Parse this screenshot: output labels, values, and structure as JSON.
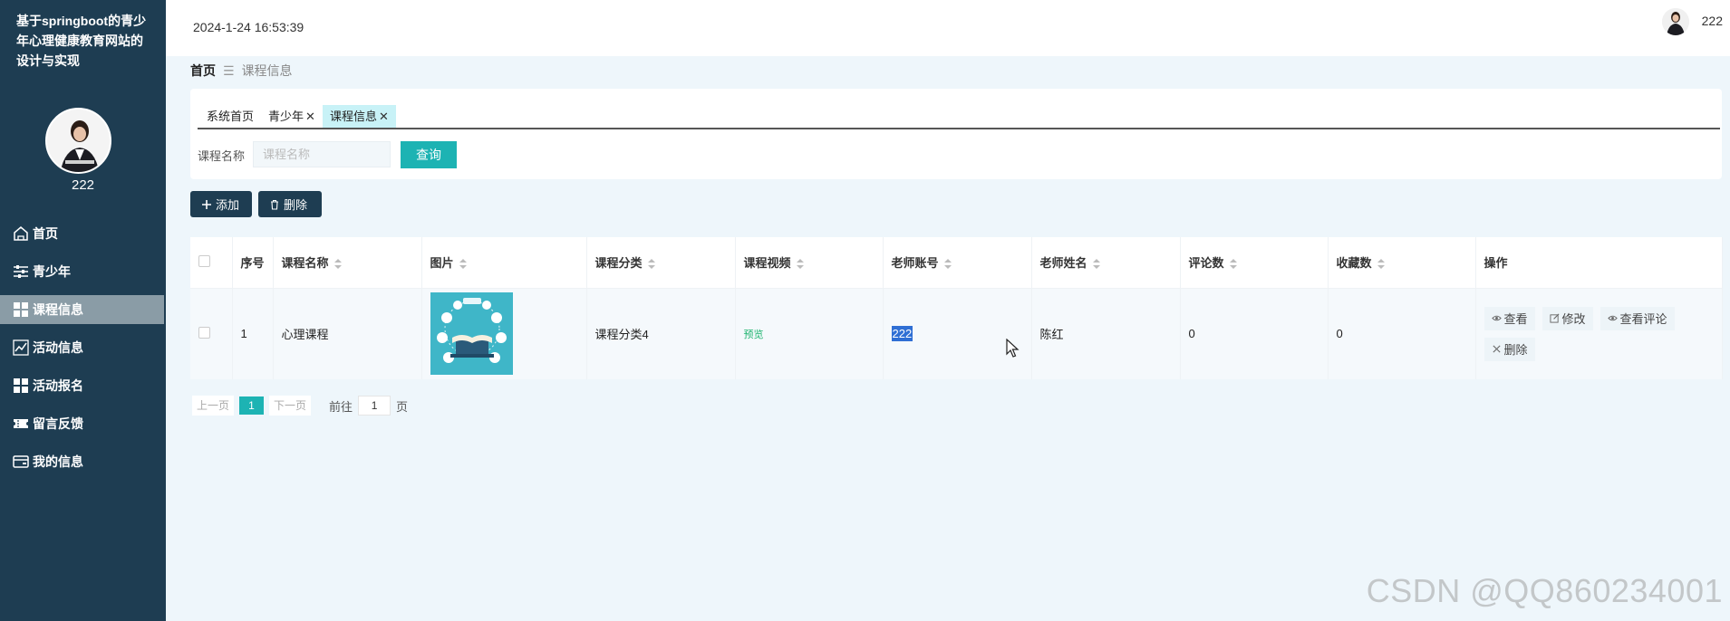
{
  "sidebar": {
    "system_title": "基于springboot的青少年心理健康教育网站的设计与实现",
    "username": "222",
    "menu": [
      {
        "label": "首页",
        "icon": "home-icon"
      },
      {
        "label": "青少年",
        "icon": "sliders-icon"
      },
      {
        "label": "课程信息",
        "icon": "grid-icon",
        "active": true
      },
      {
        "label": "活动信息",
        "icon": "chart-line-icon"
      },
      {
        "label": "活动报名",
        "icon": "grid-icon"
      },
      {
        "label": "留言反馈",
        "icon": "ticket-icon"
      },
      {
        "label": "我的信息",
        "icon": "card-icon"
      }
    ]
  },
  "header": {
    "datetime": "2024-1-24 16:53:39",
    "username": "222"
  },
  "breadcrumb": {
    "home": "首页",
    "separator": "☰",
    "current": "课程信息"
  },
  "tabs": [
    {
      "label": "系统首页",
      "closable": false
    },
    {
      "label": "青少年",
      "closable": true
    },
    {
      "label": "课程信息",
      "closable": true,
      "active": true
    }
  ],
  "search": {
    "label": "课程名称",
    "placeholder": "课程名称",
    "value": "",
    "button": "查询"
  },
  "actions": {
    "add": "添加",
    "delete": "删除"
  },
  "table": {
    "columns": [
      "序号",
      "课程名称",
      "图片",
      "课程分类",
      "课程视频",
      "老师账号",
      "老师姓名",
      "评论数",
      "收藏数",
      "操作"
    ],
    "rows": [
      {
        "index": "1",
        "name": "心理课程",
        "category": "课程分类4",
        "video": "预览",
        "teacher_account": "222",
        "teacher_name": "陈红",
        "comments": "0",
        "favorites": "0",
        "ops": [
          "查看",
          "修改",
          "查看评论",
          "删除"
        ]
      }
    ]
  },
  "pagination": {
    "prev": "上一页",
    "current": "1",
    "next": "下一页",
    "goto_label": "前往",
    "goto_value": "1",
    "unit": "页"
  },
  "watermark": "CSDN @QQ860234001",
  "colors": {
    "sidebar_bg": "#1e3d52",
    "accent": "#1db3b3",
    "active_menu": "#8a9ca6"
  }
}
